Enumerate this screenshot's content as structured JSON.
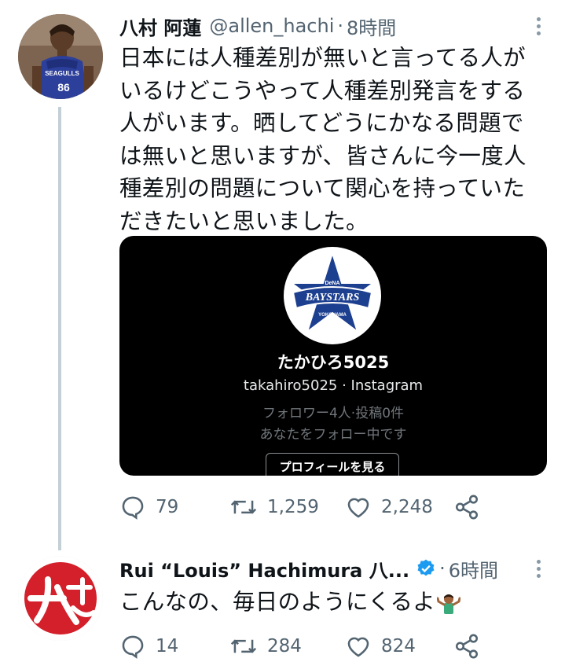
{
  "tweet1": {
    "name": "八村 阿蓮",
    "handle": "@allen_hachi",
    "separator": "·",
    "time": "8時間",
    "avatar_jersey_text": "SEAGULLS",
    "avatar_number": "86",
    "lines": [
      "日本には人種差別が無いと言ってる人が",
      "いるけどこうやって人種差別発言をする",
      "人がいます。晒してどうにかなる問題で",
      "は無いと思いますが、皆さんに今一度人",
      "種差別の問題について関心を持っていた",
      "だきたいと思いました。"
    ],
    "card": {
      "logo_text_top": "DeNA",
      "logo_text_main": "BAYSTARS",
      "logo_text_bottom": "YOKOHAMA",
      "profile_name": "たかひろ5025",
      "profile_sub": "takahiro5025 · Instagram",
      "stats1": "フォロワー4人·投稿0件",
      "stats2": "あなたをフォロー中です",
      "button": "プロフィールを見る"
    },
    "actions": {
      "replies": "79",
      "retweets": "1,259",
      "likes": "2,248"
    }
  },
  "tweet2": {
    "name": "Rui “Louis” Hachimura 八...",
    "separator": "·",
    "time": "6時間",
    "text": "こんなの、毎日のようにくるよ",
    "actions": {
      "replies": "14",
      "retweets": "284",
      "likes": "824"
    }
  },
  "colors": {
    "text": "#0f1419",
    "muted": "#536471",
    "verified": "#1d9bf0",
    "card_bg": "#000000",
    "thread_line": "#c4cfd6",
    "avatar2_red": "#d3202a"
  }
}
